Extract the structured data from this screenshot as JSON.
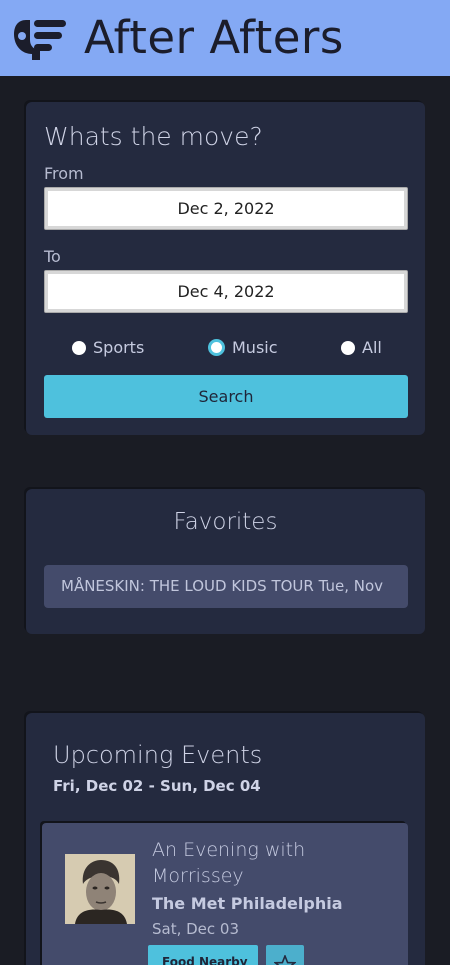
{
  "header": {
    "title": "After Afters",
    "logo_icon": "logo-icon",
    "background_color": "#84a9f4"
  },
  "search": {
    "title": "Whats the move?",
    "from_label": "From",
    "from_value": "Dec 2, 2022",
    "to_label": "To",
    "to_value": "Dec 4, 2022",
    "options": [
      "Sports",
      "Music",
      "All"
    ],
    "selected": "Music",
    "search_label": "Search",
    "accent_color": "#4ec1dd"
  },
  "favorites": {
    "title": "Favorites",
    "items": [
      "MÅNESKIN: THE LOUD KIDS TOUR Tue, Nov"
    ]
  },
  "events": {
    "title": "Upcoming Events",
    "range": "Fri, Dec 02 - Sun, Dec 04",
    "items": [
      {
        "name": "An Evening with Morrissey",
        "venue": "The Met Philadelphia",
        "date": "Sat, Dec 03",
        "food_label": "Food Nearby",
        "star_icon": "star-icon"
      }
    ]
  }
}
